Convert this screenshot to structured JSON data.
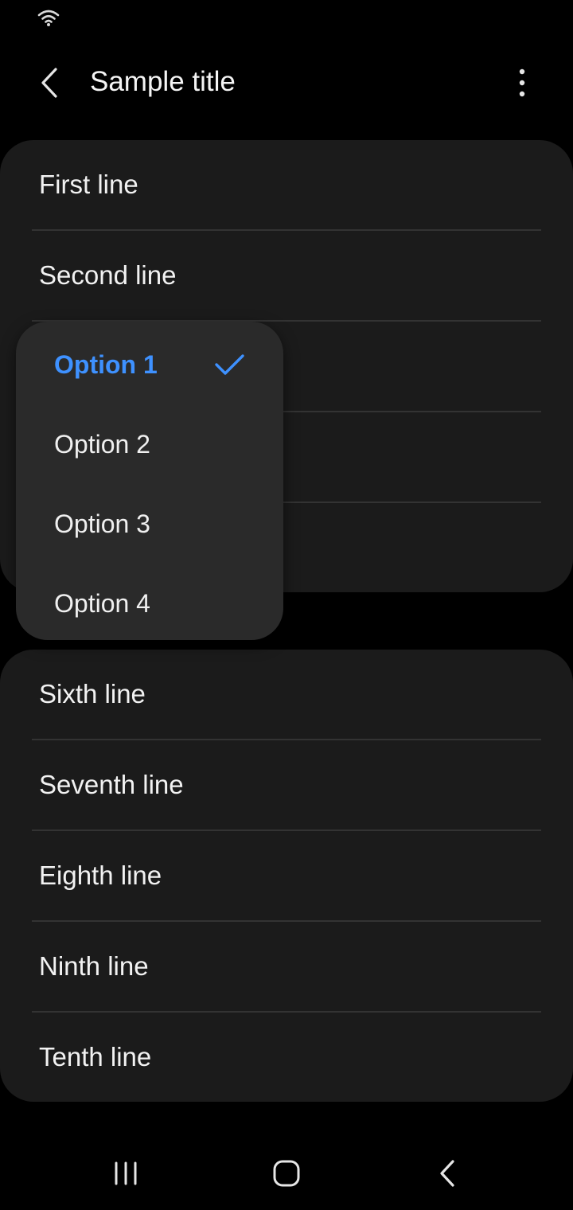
{
  "header": {
    "title": "Sample title"
  },
  "icons": {
    "status": "wifi-icon",
    "back": "chevron-left-icon",
    "more": "more-vert-icon",
    "check": "check-icon"
  },
  "colors": {
    "background": "#000000",
    "card": "#1b1b1b",
    "menu": "#2a2a2a",
    "accent": "#3e91ff",
    "divider": "#333333"
  },
  "list_group_1": {
    "items": [
      {
        "label": "First line"
      },
      {
        "label": "Second line"
      },
      {
        "label": ""
      },
      {
        "label": ""
      },
      {
        "label": ""
      }
    ]
  },
  "list_group_2": {
    "items": [
      {
        "label": "Sixth line"
      },
      {
        "label": "Seventh line"
      },
      {
        "label": "Eighth line"
      },
      {
        "label": "Ninth line"
      },
      {
        "label": "Tenth line"
      }
    ]
  },
  "popup_menu": {
    "selected_index": 0,
    "options": [
      {
        "label": "Option 1"
      },
      {
        "label": "Option 2"
      },
      {
        "label": "Option 3"
      },
      {
        "label": "Option 4"
      }
    ]
  },
  "nav_bar": {
    "buttons": [
      "recents-icon",
      "home-icon",
      "back-icon"
    ]
  }
}
